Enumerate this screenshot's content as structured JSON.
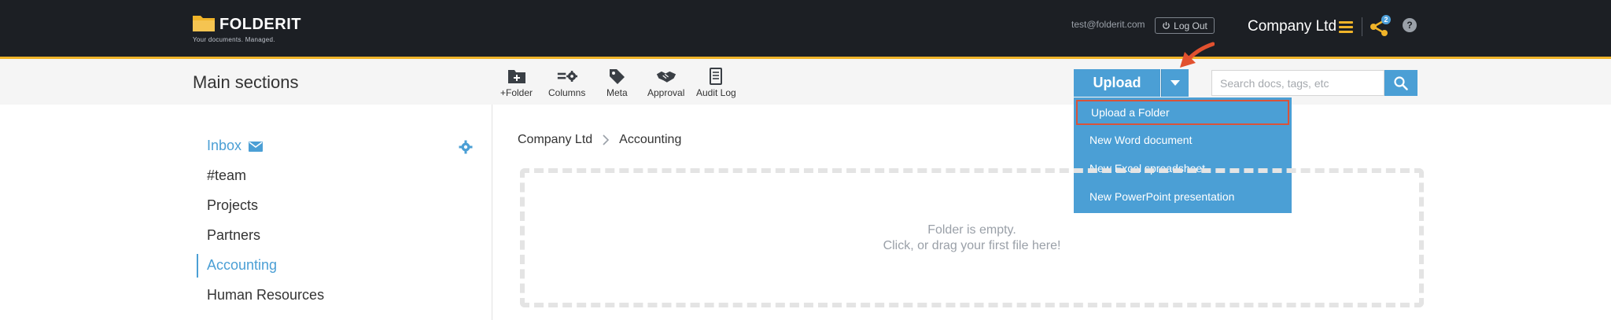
{
  "header": {
    "logo_text": "FOLDERIT",
    "tagline": "Your documents. Managed.",
    "user_email": "test@folderit.com",
    "logout_label": "Log Out",
    "company_name": "Company Ltd",
    "share_count": "2",
    "help_label": "?",
    "accent_color": "#f0b429",
    "icons": [
      "folder-logo-icon",
      "power-icon",
      "menu-icon",
      "share-icon",
      "help-icon"
    ]
  },
  "toolbar": {
    "section_title": "Main sections",
    "tools": [
      {
        "label": "+Folder",
        "icon": "folder-plus-icon"
      },
      {
        "label": "Columns",
        "icon": "columns-settings-icon"
      },
      {
        "label": "Meta",
        "icon": "tag-icon"
      },
      {
        "label": "Approval",
        "icon": "handshake-icon"
      },
      {
        "label": "Audit Log",
        "icon": "document-list-icon"
      }
    ],
    "upload_label": "Upload",
    "search_placeholder": "Search docs, tags, etc",
    "search_value": ""
  },
  "upload_menu": {
    "items": [
      {
        "label": "Upload a Folder",
        "highlighted": true
      },
      {
        "label": "New Word document"
      },
      {
        "label": "New Excel spreadsheet"
      },
      {
        "label": "New PowerPoint presentation"
      }
    ],
    "color": "#4b9fd5"
  },
  "sidebar": {
    "items": [
      {
        "label": "Inbox",
        "icon": "mail-icon"
      },
      {
        "label": "#team"
      },
      {
        "label": "Projects"
      },
      {
        "label": "Partners"
      },
      {
        "label": "Accounting",
        "active": true
      },
      {
        "label": "Human Resources"
      }
    ]
  },
  "main": {
    "breadcrumb": [
      "Company Ltd",
      "Accounting"
    ],
    "empty_line1": "Folder is empty.",
    "empty_line2": "Click, or drag your first file here!"
  }
}
